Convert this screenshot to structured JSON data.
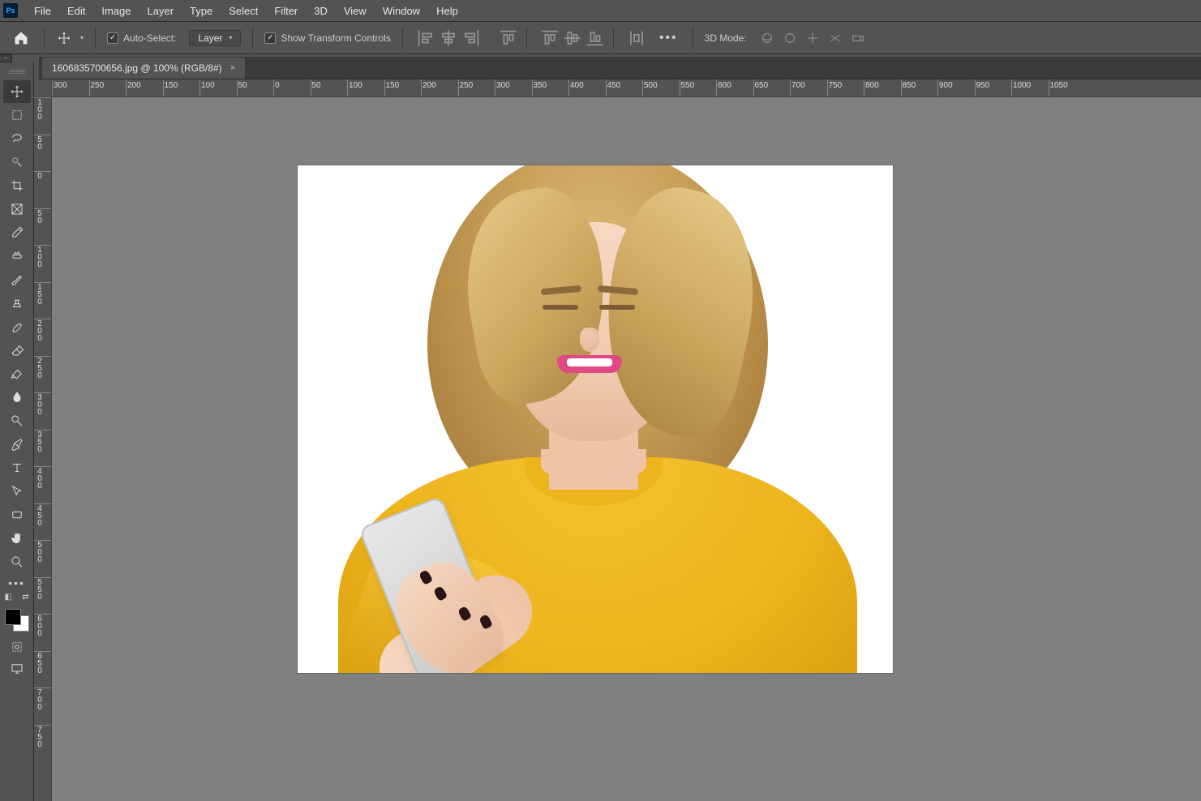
{
  "app": {
    "icon_text": "Ps"
  },
  "menu": [
    "File",
    "Edit",
    "Image",
    "Layer",
    "Type",
    "Select",
    "Filter",
    "3D",
    "View",
    "Window",
    "Help"
  ],
  "options": {
    "auto_select_label": "Auto-Select:",
    "auto_select_value": "Layer",
    "show_transform_label": "Show Transform Controls",
    "mode3d_label": "3D Mode:"
  },
  "document": {
    "tab_title": "1606835700656.jpg @ 100% (RGB/8#)"
  },
  "ruler_h": [
    "300",
    "250",
    "200",
    "150",
    "100",
    "50",
    "0",
    "50",
    "100",
    "150",
    "200",
    "250",
    "300",
    "350",
    "400",
    "450",
    "500",
    "550",
    "600",
    "650",
    "700",
    "750",
    "800",
    "850",
    "900",
    "950",
    "1000",
    "1050"
  ],
  "ruler_v": [
    "100",
    "50",
    "0",
    "50",
    "100",
    "150",
    "200",
    "250",
    "300",
    "350",
    "400",
    "450",
    "500",
    "550",
    "600",
    "650",
    "700",
    "750"
  ],
  "colors": {
    "foreground": "#000000",
    "background": "#ffffff"
  }
}
